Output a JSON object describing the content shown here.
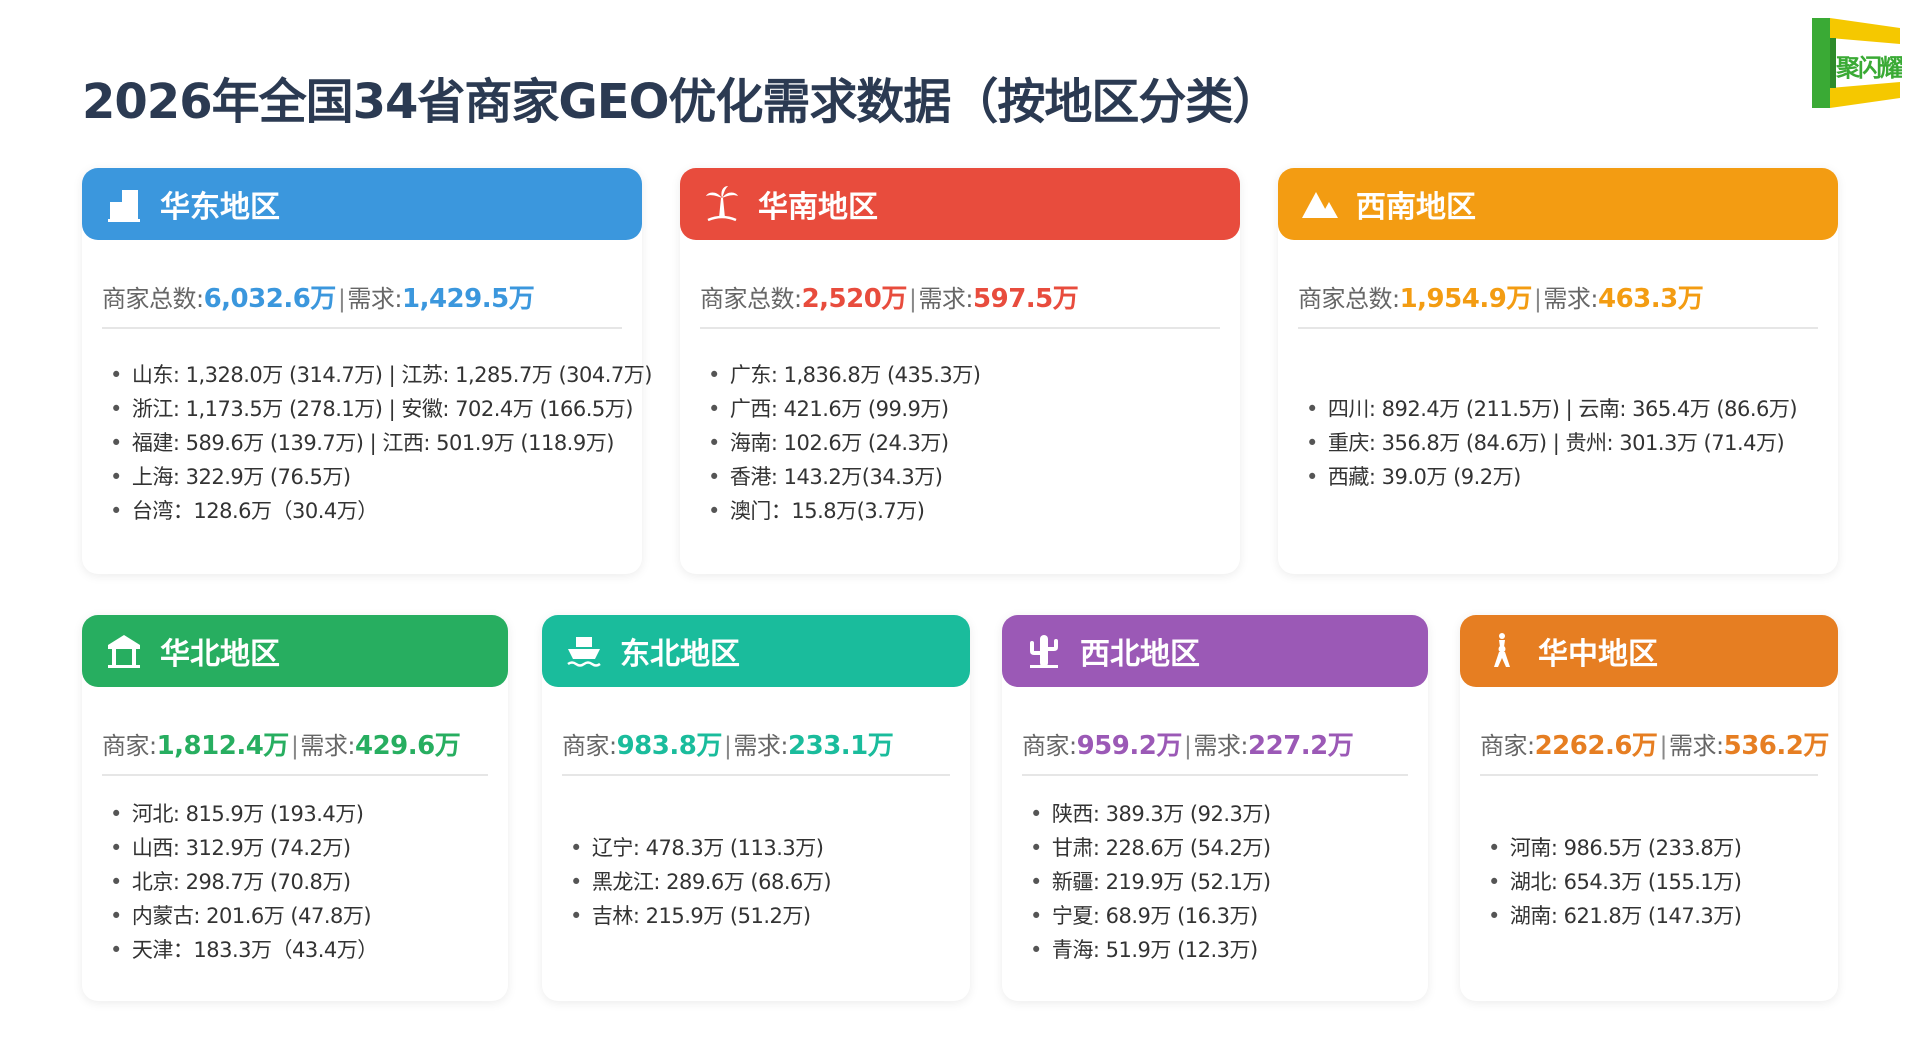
{
  "title": "2026年全国34省商家GEO优化需求数据（按地区分类）",
  "logo": {
    "text": "聚闪耀",
    "color_green": "#3aaa35",
    "color_yellow": "#f5c800"
  },
  "colors": {
    "east": "#3b97dd",
    "south": "#e84c3d",
    "southwest": "#f39c12",
    "north": "#27ae60",
    "northeast": "#1abc9c",
    "northwest": "#9b59b6",
    "central": "#e67e22"
  },
  "regions": {
    "east": {
      "name": "华东地区",
      "icon": "building-icon",
      "label1": "商家总数:",
      "value1": "6,032.6万",
      "sep": "|",
      "label2": "需求:",
      "value2": "1,429.5万",
      "items": [
        "山东: 1,328.0万 (314.7万) | 江苏: 1,285.7万 (304.7万)",
        "浙江: 1,173.5万 (278.1万) | 安徽: 702.4万 (166.5万)",
        "福建: 589.6万 (139.7万) | 江西: 501.9万 (118.9万)",
        "上海: 322.9万 (76.5万)",
        "台湾：128.6万（30.4万）"
      ]
    },
    "south": {
      "name": "华南地区",
      "icon": "palm-tree-icon",
      "label1": "商家总数:",
      "value1": "2,520万",
      "sep": "|",
      "label2": "需求:",
      "value2": "597.5万",
      "items": [
        "广东: 1,836.8万 (435.3万)",
        "广西: 421.6万 (99.9万)",
        "海南: 102.6万 (24.3万)",
        "香港: 143.2万(34.3万)",
        "澳门：15.8万(3.7万)"
      ]
    },
    "southwest": {
      "name": "西南地区",
      "icon": "mountain-icon",
      "label1": "商家总数:",
      "value1": "1,954.9万",
      "sep": "|",
      "label2": "需求:",
      "value2": "463.3万",
      "items": [
        "四川: 892.4万 (211.5万) | 云南: 365.4万 (86.6万)",
        "重庆: 356.8万 (84.6万) | 贵州: 301.3万 (71.4万)",
        "西藏: 39.0万 (9.2万)"
      ]
    },
    "north": {
      "name": "华北地区",
      "icon": "gate-icon",
      "label1": "商家:",
      "value1": "1,812.4万",
      "sep": "|",
      "label2": "需求:",
      "value2": "429.6万",
      "items": [
        "河北: 815.9万 (193.4万)",
        "山西: 312.9万 (74.2万)",
        "北京: 298.7万 (70.8万)",
        "内蒙古: 201.6万 (47.8万)",
        "天津：183.3万（43.4万）"
      ]
    },
    "northeast": {
      "name": "东北地区",
      "icon": "ship-icon",
      "label1": "商家:",
      "value1": "983.8万",
      "sep": "|",
      "label2": "需求:",
      "value2": "233.1万",
      "items": [
        "辽宁: 478.3万 (113.3万)",
        "黑龙江: 289.6万 (68.6万)",
        "吉林: 215.9万 (51.2万)"
      ]
    },
    "northwest": {
      "name": "西北地区",
      "icon": "cactus-icon",
      "label1": "商家:",
      "value1": "959.2万",
      "sep": "|",
      "label2": "需求:",
      "value2": "227.2万",
      "items": [
        "陕西: 389.3万 (92.3万)",
        "甘肃: 228.6万 (54.2万)",
        "新疆: 219.9万 (52.1万)",
        "宁夏: 68.9万 (16.3万)",
        "青海: 51.9万 (12.3万)"
      ]
    },
    "central": {
      "name": "华中地区",
      "icon": "tower-icon",
      "label1": "商家:",
      "value1": "2262.6万",
      "sep": "|",
      "label2": "需求:",
      "value2": "536.2万",
      "items": [
        "河南: 986.5万 (233.8万)",
        "湖北: 654.3万 (155.1万)",
        "湖南: 621.8万 (147.3万)"
      ]
    }
  }
}
